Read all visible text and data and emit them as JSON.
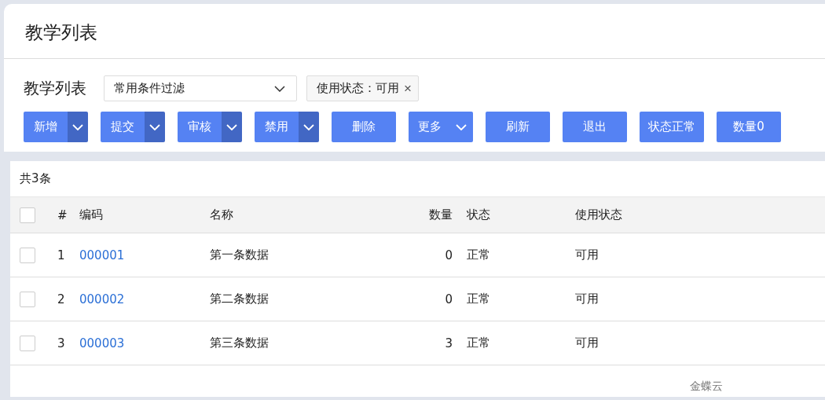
{
  "page_title": "教学列表",
  "filter_bar": {
    "title": "教学列表",
    "scheme": "常用条件过滤",
    "chips": [
      {
        "label": "使用状态：可用",
        "close": "×"
      }
    ]
  },
  "toolbar": [
    {
      "label": "新增",
      "kind": "split"
    },
    {
      "label": "提交",
      "kind": "split"
    },
    {
      "label": "审核",
      "kind": "split"
    },
    {
      "label": "禁用",
      "kind": "split"
    },
    {
      "label": "删除",
      "kind": "plain"
    },
    {
      "label": "更多",
      "kind": "menu"
    },
    {
      "label": "刷新",
      "kind": "plain"
    },
    {
      "label": "退出",
      "kind": "plain"
    },
    {
      "label": "状态正常",
      "kind": "plain"
    },
    {
      "label": "数量0",
      "kind": "plain"
    }
  ],
  "table": {
    "total": "共3条",
    "all_checked": false,
    "columns": [
      "#",
      "编码",
      "名称",
      "数量",
      "状态",
      "使用状态"
    ],
    "rows": [
      {
        "checked": false,
        "index": "1",
        "code": "000001",
        "name": "第一条数据",
        "qty": "0",
        "status": "正常",
        "use_status": "可用"
      },
      {
        "checked": false,
        "index": "2",
        "code": "000002",
        "name": "第二条数据",
        "qty": "0",
        "status": "正常",
        "use_status": "可用"
      },
      {
        "checked": false,
        "index": "3",
        "code": "000003",
        "name": "第三条数据",
        "qty": "3",
        "status": "正常",
        "use_status": "可用"
      }
    ]
  },
  "footer": "金蝶云"
}
